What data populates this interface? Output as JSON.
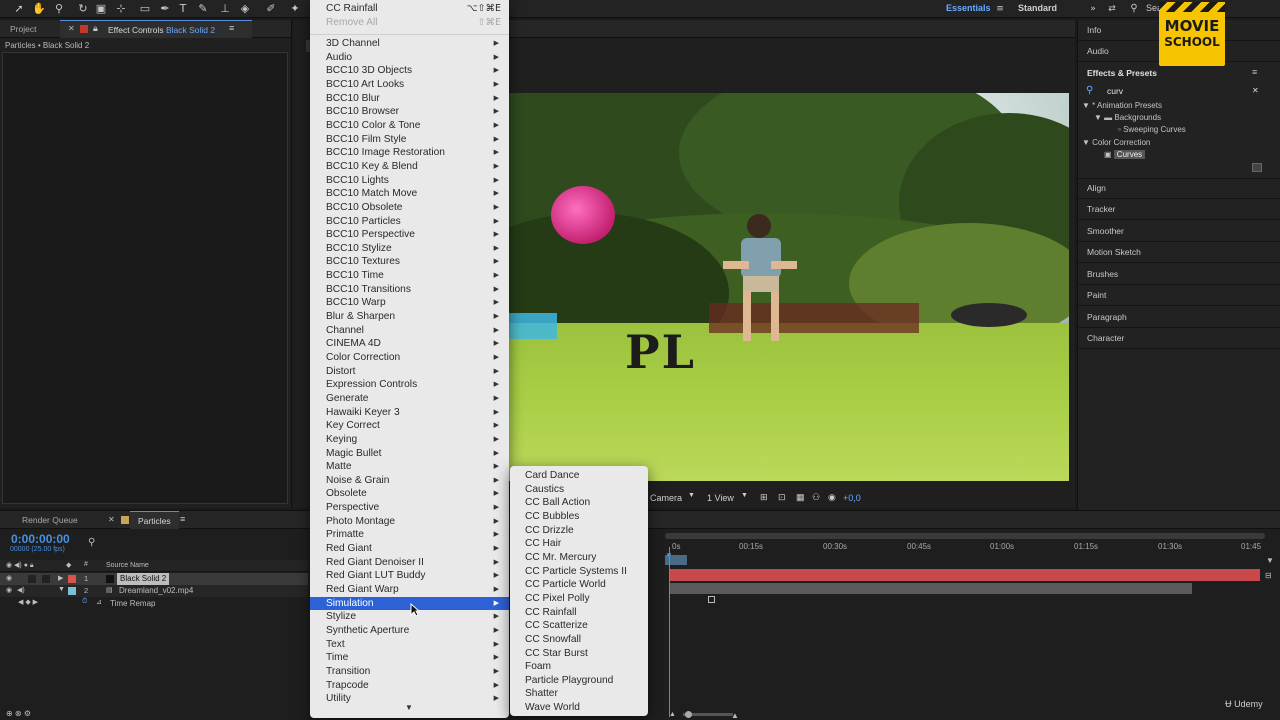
{
  "toolbar": {
    "workspaces": [
      "Essentials",
      "Standard"
    ],
    "search_label": "Sea"
  },
  "left_panel": {
    "tab_project": "Project",
    "tab_effect_controls": "Effect Controls",
    "tab_effect_layer": "Black Solid 2",
    "breadcrumb": "Particles • Black Solid 2"
  },
  "comp_toolbar": {
    "camera": "Camera",
    "views": "1 View",
    "exposure": "+0,0"
  },
  "comp_text": "PL",
  "right_panel": {
    "info": "Info",
    "audio": "Audio",
    "effects_presets": "Effects & Presets",
    "search_value": "curv",
    "tree": {
      "animation_presets": "* Animation Presets",
      "backgrounds": "Backgrounds",
      "sweeping_curves": "Sweeping Curves",
      "color_correction": "Color Correction",
      "curves": "Curves"
    },
    "panels": [
      "Align",
      "Tracker",
      "Smoother",
      "Motion Sketch",
      "Brushes",
      "Paint",
      "Paragraph",
      "Character"
    ]
  },
  "logo": {
    "line1": "MOVIE",
    "line2": "SCHOOL"
  },
  "timeline": {
    "tab_render_queue": "Render Queue",
    "tab_particles": "Particles",
    "timecode": "0:00:00:00",
    "fps": "00000 (25.00 fps)",
    "column_hash": "#",
    "column_source": "Source Name",
    "layers": [
      {
        "num": "1",
        "name": "Black Solid 2",
        "color": "#d9534f"
      },
      {
        "num": "2",
        "name": "Dreamland_v02.mp4",
        "color": "#7fbfd6"
      }
    ],
    "time_remap": "Time Remap",
    "ruler": [
      "0s",
      "00:15s",
      "00:30s",
      "00:45s",
      "01:00s",
      "01:15s",
      "01:30s",
      "01:45"
    ],
    "watermark": "Udemy"
  },
  "main_menu": {
    "top_items": [
      {
        "label": "CC Rainfall",
        "shortcut": "⌥⇧⌘E",
        "disabled": false
      },
      {
        "label": "Remove All",
        "shortcut": "⇧⌘E",
        "disabled": true
      }
    ],
    "items": [
      "3D Channel",
      "Audio",
      "BCC10 3D Objects",
      "BCC10 Art Looks",
      "BCC10 Blur",
      "BCC10 Browser",
      "BCC10 Color & Tone",
      "BCC10 Film Style",
      "BCC10 Image Restoration",
      "BCC10 Key & Blend",
      "BCC10 Lights",
      "BCC10 Match Move",
      "BCC10 Obsolete",
      "BCC10 Particles",
      "BCC10 Perspective",
      "BCC10 Stylize",
      "BCC10 Textures",
      "BCC10 Time",
      "BCC10 Transitions",
      "BCC10 Warp",
      "Blur & Sharpen",
      "Channel",
      "CINEMA 4D",
      "Color Correction",
      "Distort",
      "Expression Controls",
      "Generate",
      "Hawaiki Keyer 3",
      "Key Correct",
      "Keying",
      "Magic Bullet",
      "Matte",
      "Noise & Grain",
      "Obsolete",
      "Perspective",
      "Photo Montage",
      "Primatte",
      "Red Giant",
      "Red Giant Denoiser II",
      "Red Giant LUT Buddy",
      "Red Giant Warp",
      "Simulation",
      "Stylize",
      "Synthetic Aperture",
      "Text",
      "Time",
      "Transition",
      "Trapcode",
      "Utility"
    ],
    "selected": "Simulation"
  },
  "sub_menu": {
    "items": [
      "Card Dance",
      "Caustics",
      "CC Ball Action",
      "CC Bubbles",
      "CC Drizzle",
      "CC Hair",
      "CC Mr. Mercury",
      "CC Particle Systems II",
      "CC Particle World",
      "CC Pixel Polly",
      "CC Rainfall",
      "CC Scatterize",
      "CC Snowfall",
      "CC Star Burst",
      "Foam",
      "Particle Playground",
      "Shatter",
      "Wave World"
    ]
  },
  "colors": {
    "accent": "#2d62d6",
    "timecode": "#4a90e2",
    "layer_bar_red": "#c8484c",
    "layer_bar_gray": "#5a5a5a"
  }
}
